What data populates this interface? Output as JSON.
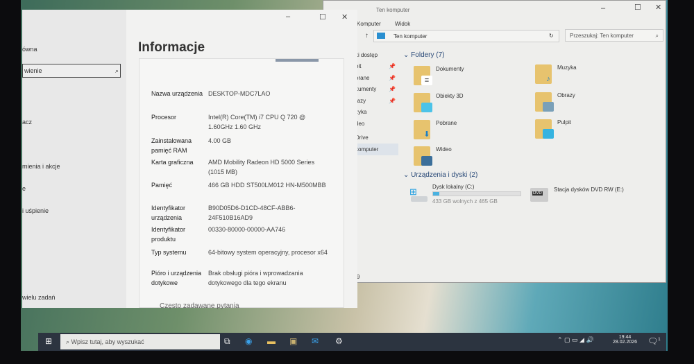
{
  "explorer": {
    "title": "Ten komputer",
    "ribbon": [
      "Komputer",
      "Widok"
    ],
    "address": "Ten komputer",
    "search_placeholder": "Przeszukaj: Ten komputer",
    "nav": [
      "ki dostęp",
      "pit",
      "orane",
      "kumenty",
      "razy",
      "zyka",
      "deo",
      "Drive",
      "komputer"
    ],
    "folders_header": "Foldery (7)",
    "folders": [
      {
        "name": "Dokumenty",
        "icon": "document"
      },
      {
        "name": "Muzyka",
        "icon": "music"
      },
      {
        "name": "Obiekty 3D",
        "icon": "cube"
      },
      {
        "name": "Obrazy",
        "icon": "picture"
      },
      {
        "name": "Pobrane",
        "icon": "download"
      },
      {
        "name": "Pulpit",
        "icon": "desktop"
      },
      {
        "name": "Wideo",
        "icon": "film"
      }
    ],
    "drives_header": "Urządzenia i dyski (2)",
    "drive_c": {
      "name": "Dysk lokalny (C:)",
      "free": "433 GB wolnych z 465 GB",
      "used_fraction": 0.07
    },
    "drive_e": {
      "name": "Stacja dysków DVD RW (E:)",
      "label": "DVD"
    },
    "status": "9"
  },
  "settings": {
    "heading": "Informacje",
    "left": [
      "ówna",
      "wienie",
      "acz",
      "mienia i akcje",
      "e",
      "i uśpienie",
      "wielu zadań"
    ],
    "specs": [
      {
        "k": "Nazwa urządzenia",
        "v": "DESKTOP-MDC7LAO"
      },
      {
        "k": "Procesor",
        "v": "Intel(R) Core(TM) i7 CPU Q 720 @ 1.60GHz 1.60 GHz"
      },
      {
        "k": "Zainstalowana pamięć RAM",
        "v": "4.00 GB"
      },
      {
        "k": "Karta graficzna",
        "v": "AMD Mobility Radeon HD 5000 Series (1015 MB)"
      },
      {
        "k": "Pamięć",
        "v": "466 GB HDD ST500LM012 HN-M500MBB"
      },
      {
        "k": "Identyfikator urządzenia",
        "v": "B90D05D6-D1CD-48CF-ABB6-24F510B16AD9"
      },
      {
        "k": "Identyfikator produktu",
        "v": "00330-80000-00000-AA746"
      },
      {
        "k": "Typ systemu",
        "v": "64-bitowy system operacyjny, procesor x64"
      },
      {
        "k": "Pióro i urządzenia dotykowe",
        "v": "Brak obsługi pióra i wprowadzania dotykowego dla tego ekranu"
      }
    ],
    "faq": "Często zadawane pytania"
  },
  "taskbar": {
    "search_placeholder": "Wpisz tutaj, aby wyszukać",
    "time": "19:44",
    "date": "28.02.2026",
    "notifications": "1"
  }
}
